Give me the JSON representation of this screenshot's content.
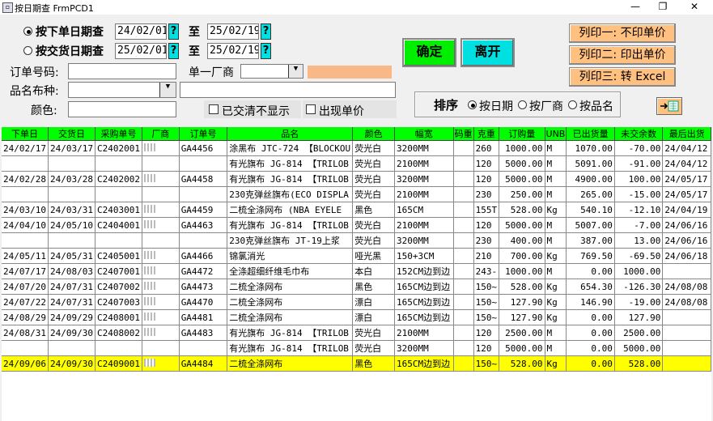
{
  "window": {
    "title": "按日期查  FrmPCD1",
    "min": "—",
    "max": "❐",
    "close": "✕"
  },
  "search": {
    "by_order_label": "按下单日期查",
    "by_delivery_label": "按交货日期查",
    "order_from": "24/02/01",
    "order_to": "25/02/19",
    "delivery_from": "25/02/01",
    "delivery_to": "25/02/19",
    "to_label": "至",
    "q": "?",
    "order_no_label": "订单号码:",
    "supplier_label": "单一厂商",
    "fabric_label": "品名布种:",
    "color_label": "颜色:",
    "hide_cleared_label": "已交清不显示",
    "show_price_label": "出现单价",
    "order_no_value": "",
    "fabric_value": "",
    "color_value": ""
  },
  "buttons": {
    "ok": "确定",
    "leave": "离开",
    "print1": "列印一: 不印单价",
    "print2": "列印二: 印出单价",
    "print3": "列印三: 转 Excel",
    "export_icon": "excel-export-icon"
  },
  "sort": {
    "label": "排序",
    "by_date": "按日期",
    "by_supplier": "按厂商",
    "by_product": "按品名"
  },
  "table": {
    "columns": [
      "下单日",
      "交货日",
      "采购单号",
      "厂商",
      "订单号",
      "品名",
      "颜色",
      "幅宽",
      "码重",
      "克重",
      "订购量",
      "UNB",
      "已出货量",
      "未交余数",
      "最后出货"
    ],
    "rows": [
      {
        "c": [
          "24/02/17",
          "24/03/17",
          "C2402001",
          "▒",
          "GA4456",
          "涂黑布 JTC-724 【BLOCKOU",
          "荧光白",
          "3200MM",
          "",
          "260",
          "1000.00",
          "M",
          "1070.00",
          "-70.00",
          "24/04/12"
        ]
      },
      {
        "c": [
          "",
          "",
          "",
          "",
          "",
          "有光旗布 JG-814 【TRILOB",
          "荧光白",
          "2100MM",
          "",
          "120",
          "5000.00",
          "M",
          "5091.00",
          "-91.00",
          "24/04/12"
        ]
      },
      {
        "c": [
          "24/02/28",
          "24/03/28",
          "C2402002",
          "▒",
          "GA4458",
          "有光旗布 JG-814 【TRILOB",
          "荧光白",
          "3200MM",
          "",
          "120",
          "5000.00",
          "M",
          "4900.00",
          "100.00",
          "24/05/17"
        ]
      },
      {
        "c": [
          "",
          "",
          "",
          "",
          "",
          "230克弹丝旗布(ECO DISPLA",
          "荧光白",
          "2100MM",
          "",
          "230",
          "250.00",
          "M",
          "265.00",
          "-15.00",
          "24/05/17"
        ]
      },
      {
        "c": [
          "24/03/10",
          "24/03/31",
          "C2403001",
          "▒",
          "GA4459",
          "二梳全涤网布 (NBA EYELE",
          "黑色",
          "165CM",
          "",
          "155T",
          "528.00",
          "Kg",
          "540.10",
          "-12.10",
          "24/04/19"
        ]
      },
      {
        "c": [
          "24/04/10",
          "24/05/10",
          "C2404001",
          "▒",
          "GA4463",
          "有光旗布 JG-814 【TRILOB",
          "荧光白",
          "2100MM",
          "",
          "120",
          "5000.00",
          "M",
          "5007.00",
          "-7.00",
          "24/06/16"
        ]
      },
      {
        "c": [
          "",
          "",
          "",
          "",
          "",
          "230克弹丝旗布 JT-19上浆",
          "荧光白",
          "3200MM",
          "",
          "230",
          "400.00",
          "M",
          "387.00",
          "13.00",
          "24/06/16"
        ]
      },
      {
        "c": [
          "24/05/11",
          "24/05/31",
          "C2405001",
          "▒",
          "GA4466",
          "锦氯消光",
          "哑光黑",
          "150+3CM",
          "",
          "210",
          "700.00",
          "Kg",
          "769.50",
          "-69.50",
          "24/06/18"
        ]
      },
      {
        "c": [
          "24/07/17",
          "24/08/03",
          "C2407001",
          "▒",
          "GA4472",
          "全涤超细纤维毛巾布",
          "本白",
          "152CM边到边",
          "",
          "243-",
          "1000.00",
          "M",
          "0.00",
          "1000.00",
          ""
        ]
      },
      {
        "c": [
          "24/07/20",
          "24/07/31",
          "C2407002",
          "▒",
          "GA4473",
          "二梳全涤网布",
          "黑色",
          "165CM边到边",
          "",
          "150~",
          "528.00",
          "Kg",
          "654.30",
          "-126.30",
          "24/08/08"
        ]
      },
      {
        "c": [
          "24/07/22",
          "24/07/31",
          "C2407003",
          "▒",
          "GA4470",
          "二梳全涤网布",
          "漂白",
          "165CM边到边",
          "",
          "150~",
          "127.90",
          "Kg",
          "146.90",
          "-19.00",
          "24/08/08"
        ]
      },
      {
        "c": [
          "24/08/29",
          "24/09/29",
          "C2408001",
          "▒",
          "GA4481",
          "二梳全涤网布",
          "漂白",
          "165CM边到边",
          "",
          "150~",
          "127.90",
          "Kg",
          "0.00",
          "127.90",
          ""
        ]
      },
      {
        "c": [
          "24/08/31",
          "24/09/30",
          "C2408002",
          "▒",
          "GA4483",
          "有光旗布 JG-814 【TRILOB",
          "荧光白",
          "2100MM",
          "",
          "120",
          "2500.00",
          "M",
          "0.00",
          "2500.00",
          ""
        ]
      },
      {
        "c": [
          "",
          "",
          "",
          "",
          "",
          "有光旗布 JG-814 【TRILOB",
          "荧光白",
          "3200MM",
          "",
          "120",
          "5000.00",
          "M",
          "0.00",
          "5000.00",
          ""
        ]
      },
      {
        "c": [
          "24/09/06",
          "24/09/30",
          "C2409001",
          "▒",
          "GA4484",
          "二梳全涤网布",
          "黑色",
          "165CM边到边",
          "",
          "150~",
          "528.00",
          "Kg",
          "0.00",
          "528.00",
          ""
        ],
        "highlight": true
      }
    ]
  },
  "colors": {
    "header_green": "#00ff00",
    "highlight_yellow": "#ffff00",
    "cyan_button": "#00e0e0",
    "print_button": "#ffc080"
  }
}
